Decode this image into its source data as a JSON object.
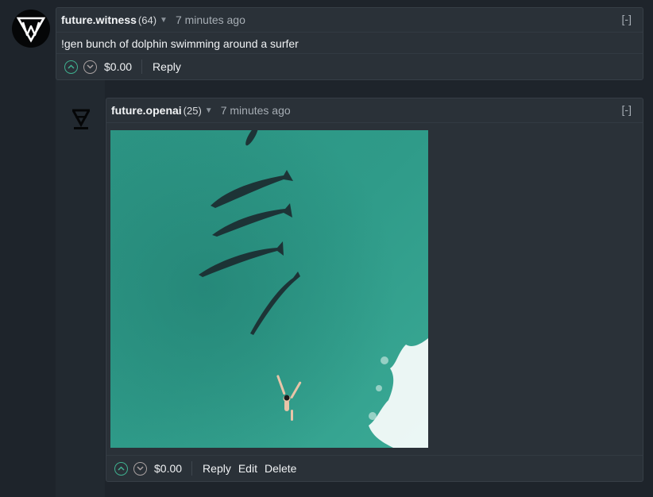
{
  "top_comment": {
    "avatar_icon": "triangle-w-logo-icon",
    "username": "future.witness",
    "reputation": "(64)",
    "timestamp": "7 minutes ago",
    "collapse_label": "[-]",
    "body": "!gen bunch of dolphin swimming around a surfer",
    "payout": "$0.00",
    "actions": {
      "reply": "Reply"
    }
  },
  "reply_comment": {
    "avatar_icon": "openai-logo-icon",
    "username": "future.openai",
    "reputation": "(25)",
    "timestamp": "7 minutes ago",
    "collapse_label": "[-]",
    "image_icon": "generated-image",
    "payout": "$0.00",
    "actions": {
      "reply": "Reply",
      "edit": "Edit",
      "delete": "Delete"
    }
  },
  "colors": {
    "background": "#1e242b",
    "card": "#2a3138",
    "upvote": "#3fb08f",
    "downvote": "#a8a0a0",
    "ocean": "#2f9a88"
  }
}
